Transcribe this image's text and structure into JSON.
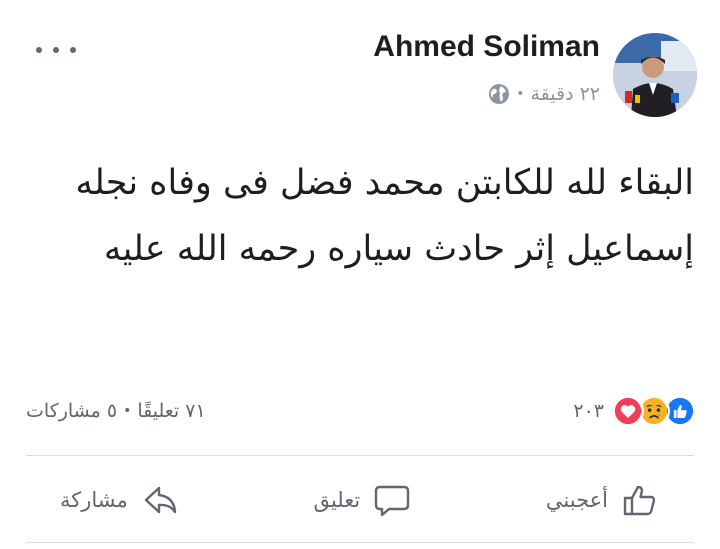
{
  "post": {
    "author": "Ahmed Soliman",
    "time": "٢٢ دقيقة",
    "privacy_icon": "globe-icon",
    "text": "البقاء لله للكابتن محمد فضل فى وفاه نجله إسماعيل إثر حادث سياره رحمه الله عليه"
  },
  "reactions": {
    "types": [
      "like-icon",
      "sad-icon",
      "love-icon"
    ],
    "count": "٢٠٣"
  },
  "stats": {
    "comments": "٧١ تعليقًا",
    "shares": "٥ مشاركات"
  },
  "actions": {
    "like_label": "أعجبني",
    "comment_label": "تعليق",
    "share_label": "مشاركة"
  },
  "colors": {
    "like_blue": "#1877f2",
    "sad_yellow": "#f7b125",
    "love_red": "#f33e58",
    "meta_gray": "#8d949e"
  }
}
